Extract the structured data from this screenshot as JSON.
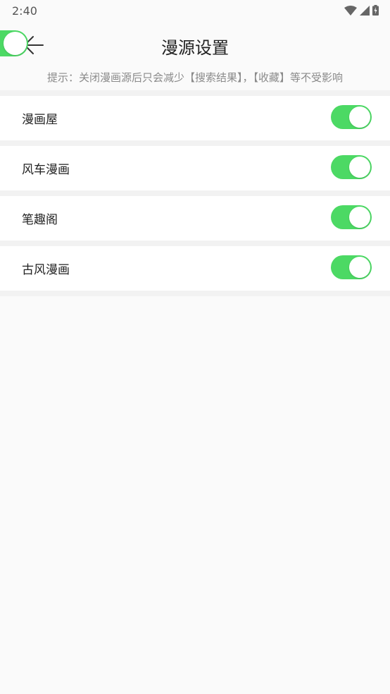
{
  "status_bar": {
    "time": "2:40",
    "icons": [
      "wifi-icon",
      "cell-signal-icon",
      "battery-charging-icon"
    ]
  },
  "header": {
    "title": "漫源设置",
    "back_icon": "arrow-left-icon",
    "master_toggle_on": true
  },
  "hint": "提示：关闭漫画源后只会减少【搜索结果】，【收藏】等不受影响",
  "sources": [
    {
      "label": "漫画屋",
      "enabled": true
    },
    {
      "label": "风车漫画",
      "enabled": true
    },
    {
      "label": "笔趣阁",
      "enabled": true
    },
    {
      "label": "古风漫画",
      "enabled": true
    }
  ],
  "colors": {
    "toggle_on": "#4cd964",
    "background": "#fafafa",
    "row_bg": "#ffffff"
  }
}
